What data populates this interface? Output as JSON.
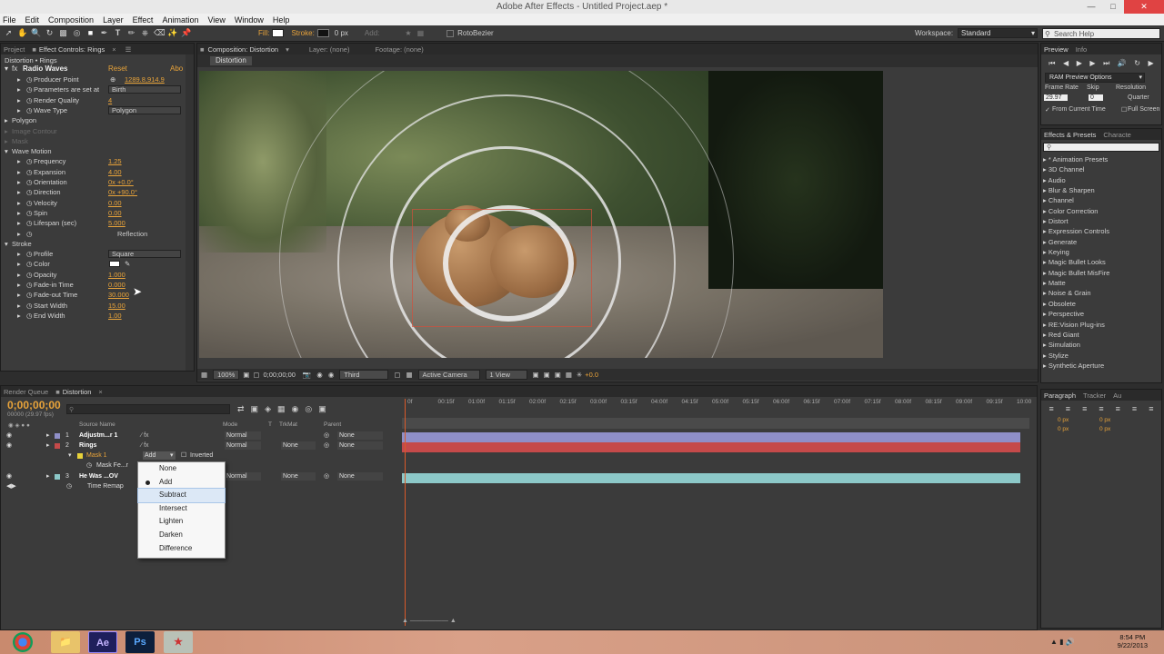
{
  "app": {
    "title": "Adobe After Effects - Untitled Project.aep *"
  },
  "menu": [
    "File",
    "Edit",
    "Composition",
    "Layer",
    "Effect",
    "Animation",
    "View",
    "Window",
    "Help"
  ],
  "toolbar": {
    "fill_label": "Fill:",
    "stroke_label": "Stroke:",
    "stroke_px": "0 px",
    "add_label": "Add:",
    "rotobezier": "RotoBezier",
    "workspace_label": "Workspace:",
    "workspace_value": "Standard",
    "search_placeholder": "Search Help"
  },
  "project_tabs": {
    "project": "Project",
    "effect_controls": "Effect Controls: Rings"
  },
  "comp_tabs": {
    "composition": "Composition: Distortion",
    "layer": "Layer: (none)",
    "footage": "Footage: (none)",
    "breadcrumb": "Distortion"
  },
  "effect_controls": {
    "header": "Distortion • Rings",
    "effect_name": "Radio Waves",
    "reset": "Reset",
    "about": "Abo",
    "rows": [
      {
        "label": "Producer Point",
        "value": "1289.8,914.9",
        "kind": "val"
      },
      {
        "label": "Parameters are set at",
        "value": "Birth",
        "kind": "dd"
      },
      {
        "label": "Render Quality",
        "value": "4",
        "kind": "val"
      },
      {
        "label": "Wave Type",
        "value": "Polygon",
        "kind": "dd"
      },
      {
        "label": "Polygon",
        "value": "",
        "kind": "group"
      },
      {
        "label": "Image Contour",
        "value": "",
        "kind": "dim"
      },
      {
        "label": "Mask",
        "value": "",
        "kind": "dim"
      },
      {
        "label": "Wave Motion",
        "value": "",
        "kind": "group"
      },
      {
        "label": "Frequency",
        "value": "1.25",
        "kind": "val"
      },
      {
        "label": "Expansion",
        "value": "4.00",
        "kind": "val"
      },
      {
        "label": "Orientation",
        "value": "0x +0.0°",
        "kind": "val"
      },
      {
        "label": "Direction",
        "value": "0x +90.0°",
        "kind": "val"
      },
      {
        "label": "Velocity",
        "value": "0.00",
        "kind": "val"
      },
      {
        "label": "Spin",
        "value": "0.00",
        "kind": "val"
      },
      {
        "label": "Lifespan (sec)",
        "value": "5.000",
        "kind": "val"
      },
      {
        "label": "",
        "value": "Reflection",
        "kind": "check"
      },
      {
        "label": "Stroke",
        "value": "",
        "kind": "group"
      },
      {
        "label": "Profile",
        "value": "Square",
        "kind": "dd"
      },
      {
        "label": "Color",
        "value": "",
        "kind": "color"
      },
      {
        "label": "Opacity",
        "value": "1.000",
        "kind": "val"
      },
      {
        "label": "Fade-in Time",
        "value": "0.000",
        "kind": "val"
      },
      {
        "label": "Fade-out Time",
        "value": "30.000",
        "kind": "val"
      },
      {
        "label": "Start Width",
        "value": "15.00",
        "kind": "val"
      },
      {
        "label": "End Width",
        "value": "1.00",
        "kind": "val"
      }
    ]
  },
  "viewer_bar": {
    "zoom": "100%",
    "timecode": "0;00;00;00",
    "resolution": "Third",
    "camera": "Active Camera",
    "views": "1 View",
    "exposure": "+0.0"
  },
  "preview": {
    "tab": "Preview",
    "tab2": "Info",
    "ram": "RAM Preview Options",
    "frame_rate_label": "Frame Rate",
    "skip_label": "Skip",
    "resolution_label": "Resolution",
    "frame_rate": "29.97",
    "skip": "0",
    "resolution": "Quarter",
    "from_current": "From Current Time",
    "full_screen": "Full Screen"
  },
  "effects_presets": {
    "tab": "Effects & Presets",
    "tab2": "Characte",
    "items": [
      "* Animation Presets",
      "3D Channel",
      "Audio",
      "Blur & Sharpen",
      "Channel",
      "Color Correction",
      "Distort",
      "Expression Controls",
      "Generate",
      "Keying",
      "Magic Bullet Looks",
      "Magic Bullet MisFire",
      "Matte",
      "Noise & Grain",
      "Obsolete",
      "Perspective",
      "RE:Vision Plug-ins",
      "Red Giant",
      "Simulation",
      "Stylize",
      "Synthetic Aperture"
    ]
  },
  "paragraph": {
    "tab": "Paragraph",
    "tab2": "Tracker",
    "tab3": "Au",
    "px1": "0 px",
    "px2": "0 px",
    "px3": "0 px",
    "px4": "0 px",
    "px5": "0 px"
  },
  "timeline": {
    "tabs": [
      "Render Queue",
      "Distortion"
    ],
    "timecode": "0;00;00;00",
    "fps": "00000 (29.97 fps)",
    "cols": {
      "source": "Source Name",
      "mode": "Mode",
      "t": "T",
      "trkmat": "TrkMat",
      "parent": "Parent"
    },
    "ruler": [
      "0f",
      "00:15f",
      "01:00f",
      "01:15f",
      "02:00f",
      "02:15f",
      "03:00f",
      "03:15f",
      "04:00f",
      "04:15f",
      "05:00f",
      "05:15f",
      "06:00f",
      "06:15f",
      "07:00f",
      "07:15f",
      "08:00f",
      "08:15f",
      "09:00f",
      "09:15f",
      "10:00"
    ],
    "layers": [
      {
        "num": "1",
        "name": "Adjustm...r 1",
        "mode": "Normal",
        "trkmat": "",
        "parent": "None",
        "color": "#8f8fc8"
      },
      {
        "num": "2",
        "name": "Rings",
        "mode": "Normal",
        "trkmat": "None",
        "parent": "None",
        "color": "#c54a4a"
      },
      {
        "num": "3",
        "name": "He Was ...OV",
        "mode": "Normal",
        "trkmat": "None",
        "parent": "None",
        "color": "#8cc8c8"
      }
    ],
    "mask_label": "Mask 1",
    "mask_mode": "Add",
    "inverted": "Inverted",
    "mask_feather": "Mask Fe...r",
    "time_remap": "Time Remap"
  },
  "mask_mode_menu": {
    "items": [
      "None",
      "Add",
      "Subtract",
      "Intersect",
      "Lighten",
      "Darken",
      "Difference"
    ],
    "checked": "Add",
    "highlighted": "Subtract"
  },
  "taskbar": {
    "time": "8:54 PM",
    "date": "9/22/2013"
  }
}
